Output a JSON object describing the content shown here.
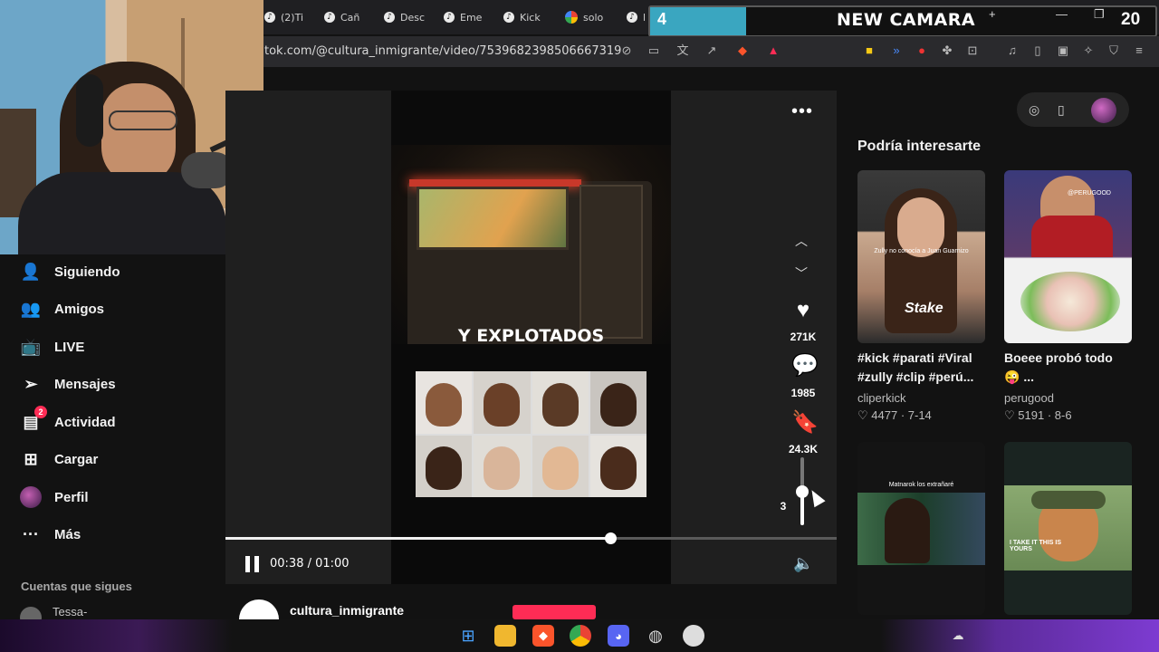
{
  "browser": {
    "tabs": [
      {
        "label": "(2)Ti"
      },
      {
        "label": "Cañ"
      },
      {
        "label": "Desc"
      },
      {
        "label": "Eme"
      },
      {
        "label": "Kick"
      },
      {
        "label": "solo"
      },
      {
        "label": "l"
      }
    ],
    "url": "tok.com/@cultura_inmigrante/video/7539682398506667319",
    "new_tab_label": "+"
  },
  "overlay": {
    "left_number": "4",
    "title": "NEW CAMARA",
    "right_number": "20"
  },
  "sidebar": {
    "items": [
      {
        "label": "Siguiendo",
        "icon": "following-icon"
      },
      {
        "label": "Amigos",
        "icon": "friends-icon"
      },
      {
        "label": "LIVE",
        "icon": "live-icon"
      },
      {
        "label": "Mensajes",
        "icon": "messages-icon"
      },
      {
        "label": "Actividad",
        "icon": "activity-icon",
        "badge": "2"
      },
      {
        "label": "Cargar",
        "icon": "upload-icon"
      },
      {
        "label": "Perfil",
        "icon": "avatar"
      },
      {
        "label": "Más",
        "icon": "more-icon"
      }
    ],
    "following_section": "Cuentas que sigues",
    "following_first": "Tessa-"
  },
  "video": {
    "caption": "Y EXPLOTADOS",
    "likes": "271K",
    "comments": "1985",
    "saves": "24.3K",
    "shares": "3",
    "current_time": "00:38 / 01:00",
    "progress": 0.63,
    "volume": 0.5,
    "author": "cultura_inmigrante"
  },
  "right_panel": {
    "title": "Podría interesarte",
    "videos": [
      {
        "title": "#kick #parati #Viral #zully #clip #perú...",
        "author": "cliperkick",
        "stats": "4477 · 7-14",
        "thumb_text": "Zully no conocía a Juan Guarnizo",
        "brand": "Stake"
      },
      {
        "title": "Boeee probó todo 😜 ...",
        "author": "perugood",
        "stats": "5191 · 8-6",
        "thumb_text": "@PERUGOOD",
        "brand": ""
      },
      {
        "title": "",
        "author": "",
        "stats": "",
        "thumb_text": "Matnarok los extrañaré",
        "brand": ""
      },
      {
        "title": "",
        "author": "",
        "stats": "",
        "thumb_text": "I TAKE IT THIS IS YOURS",
        "brand": ""
      }
    ]
  },
  "colors": {
    "accent": "#fe2c55",
    "background": "#121212",
    "overlay_cyan": "#3aa6c0"
  }
}
